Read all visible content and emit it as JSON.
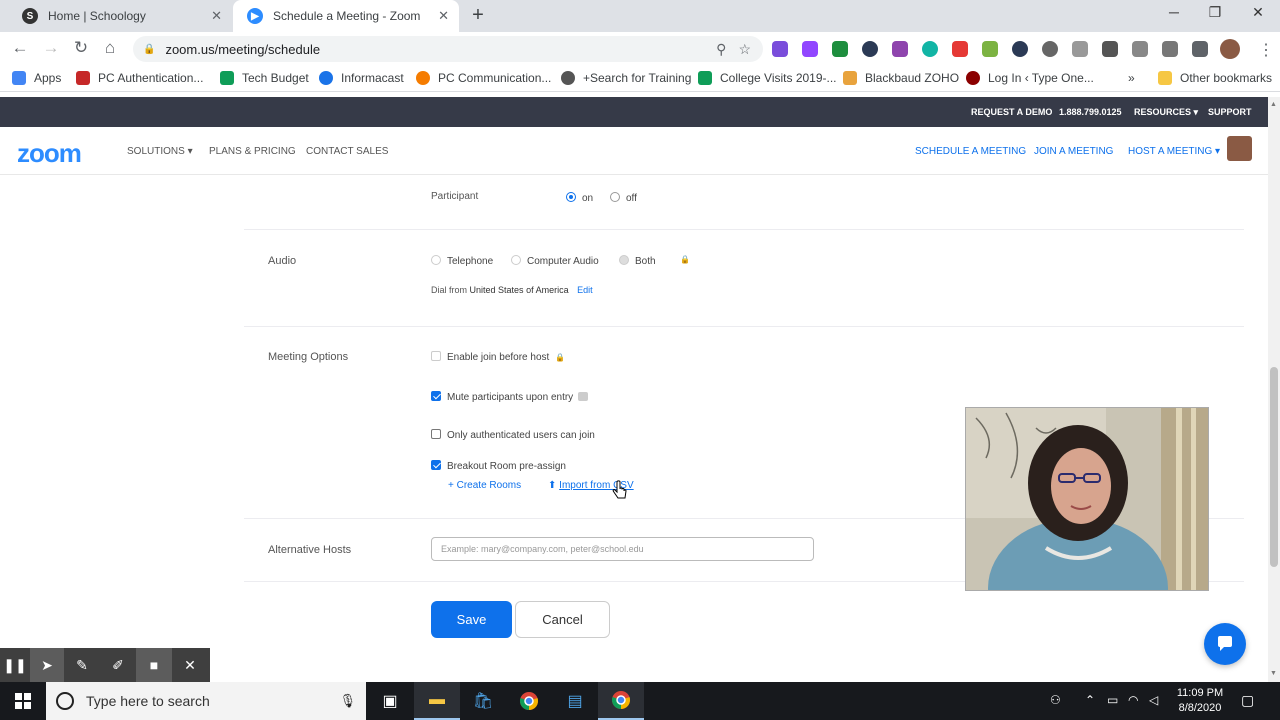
{
  "browser": {
    "tabs": [
      {
        "title": "Home | Schoology",
        "active": false
      },
      {
        "title": "Schedule a Meeting - Zoom",
        "active": true
      }
    ],
    "url": "zoom.us/meeting/schedule",
    "bookmarks": [
      "Apps",
      "PC Authentication...",
      "Tech Budget",
      "Informacast",
      "PC Communication...",
      "+Search for Training",
      "College Visits 2019-...",
      "Blackbaud ZOHO",
      "Log In ‹ Type One...",
      "Other bookmarks"
    ]
  },
  "zoom": {
    "topbar": {
      "request_demo": "REQUEST A DEMO",
      "phone": "1.888.799.0125",
      "resources": "RESOURCES",
      "support": "SUPPORT"
    },
    "logo": "zoom",
    "nav_left": {
      "solutions": "SOLUTIONS",
      "plans": "PLANS & PRICING",
      "contact": "CONTACT SALES"
    },
    "nav_right": {
      "schedule": "SCHEDULE A MEETING",
      "join": "JOIN A MEETING",
      "host": "HOST A MEETING"
    }
  },
  "form": {
    "participant": {
      "label": "Participant",
      "on": "on",
      "off": "off",
      "selected": "on"
    },
    "audio": {
      "label": "Audio",
      "options": [
        "Telephone",
        "Computer Audio",
        "Both"
      ],
      "selected": "Both",
      "dial_prefix": "Dial from",
      "dial_country": "United States of America",
      "edit": "Edit"
    },
    "meeting_options": {
      "label": "Meeting Options",
      "enable_join": "Enable join before host",
      "mute": "Mute participants upon entry",
      "authenticated": "Only authenticated users can join",
      "breakout": "Breakout Room pre-assign",
      "create_rooms": "Create Rooms",
      "import_csv": "Import from CSV"
    },
    "alt_hosts": {
      "label": "Alternative Hosts",
      "placeholder": "Example: mary@company.com, peter@school.edu"
    },
    "save": "Save",
    "cancel": "Cancel"
  },
  "taskbar": {
    "search_placeholder": "Type here to search",
    "time": "11:09 PM",
    "date": "8/8/2020"
  }
}
